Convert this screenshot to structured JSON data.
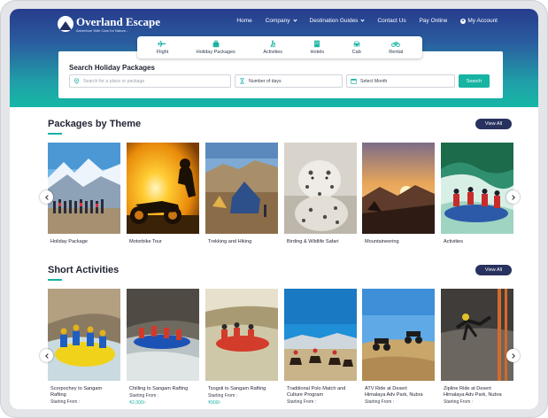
{
  "brand": {
    "name": "Overland Escape",
    "tagline": "Adventure With Care for Nature..."
  },
  "nav": {
    "items": [
      {
        "label": "Home",
        "dropdown": false
      },
      {
        "label": "Company",
        "dropdown": true
      },
      {
        "label": "Destination Guides",
        "dropdown": true
      },
      {
        "label": "Contact Us",
        "dropdown": false
      },
      {
        "label": "Pay Online",
        "dropdown": false
      }
    ],
    "account_label": "My Account"
  },
  "modes": [
    {
      "label": "Flight",
      "icon": "plane-icon"
    },
    {
      "label": "Holiday Packages",
      "icon": "suitcase-icon"
    },
    {
      "label": "Activities",
      "icon": "hiker-icon"
    },
    {
      "label": "Hotels",
      "icon": "hotel-icon"
    },
    {
      "label": "Cab",
      "icon": "car-icon"
    },
    {
      "label": "Rental",
      "icon": "bicycle-icon"
    }
  ],
  "search": {
    "title": "Search Holiday Packages",
    "place_placeholder": "Search for a place or package",
    "days_value": "Number of days",
    "month_value": "Select Month",
    "button_label": "Search"
  },
  "themes": {
    "title": "Packages by Theme",
    "view_all": "View All",
    "items": [
      {
        "label": "Holiday Package"
      },
      {
        "label": "Motorbike Tour"
      },
      {
        "label": "Trekking and Hiking"
      },
      {
        "label": "Birding & Wildlife Safari"
      },
      {
        "label": "Mountaineering"
      },
      {
        "label": "Activities"
      }
    ]
  },
  "short_activities": {
    "title": "Short Activities",
    "view_all": "View All",
    "items": [
      {
        "title_line1": "Scorpochey to Sangam",
        "title_line2": "Rafting",
        "starting": "Starting From :",
        "price": ""
      },
      {
        "title_line1": "Chilling to Sangam Rafting",
        "title_line2": "",
        "starting": "Starting From :",
        "price": "₹2,000/-"
      },
      {
        "title_line1": "Tsogsti to Sangam Rafting",
        "title_line2": "",
        "starting": "Starting From :",
        "price": "₹900/-"
      },
      {
        "title_line1": "Traditional Polo Match and",
        "title_line2": "Culture Program",
        "starting": "Starting From :",
        "price": ""
      },
      {
        "title_line1": "ATV Ride at Desert",
        "title_line2": "Himalaya Adv Park, Nubra",
        "starting": "Starting From :",
        "price": ""
      },
      {
        "title_line1": "Zipline Ride at Desert",
        "title_line2": "Himalaya Adv Park, Nubra",
        "starting": "Starting From :",
        "price": ""
      }
    ]
  },
  "colors": {
    "accent": "#17b3a3",
    "navy": "#28325f",
    "hero_top": "#273c8c",
    "hero_bottom": "#16b7a6"
  }
}
